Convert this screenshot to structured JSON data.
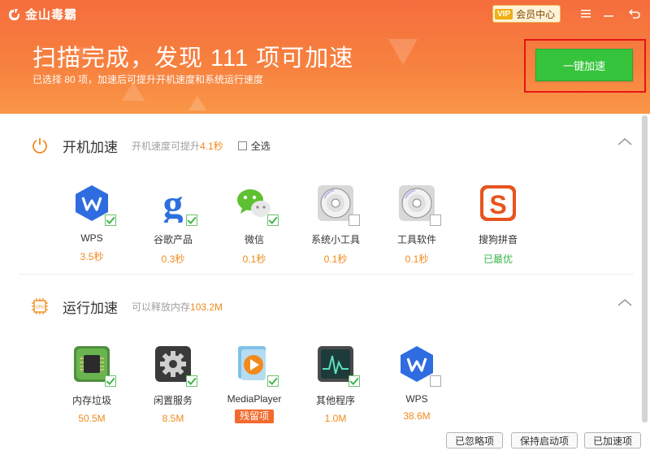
{
  "app": {
    "name": "金山毒霸"
  },
  "window_controls": {
    "vip_badge": "VIP",
    "vip_label": "会员中心"
  },
  "header": {
    "title": "扫描完成，发现 111 项可加速",
    "subtitle": "已选择 80 项，加速后可提升开机速度和系统运行速度",
    "accelerate_button": "一键加速"
  },
  "startup": {
    "title": "开机加速",
    "hint_prefix": "开机速度可提升",
    "hint_value": "4.1秒",
    "select_all_label": "全选",
    "items": [
      {
        "label": "WPS",
        "value": "3.5秒",
        "icon": "wps-icon",
        "checked": true
      },
      {
        "label": "谷歌产品",
        "value": "0.3秒",
        "icon": "google-icon",
        "checked": true
      },
      {
        "label": "微信",
        "value": "0.1秒",
        "icon": "wechat-icon",
        "checked": true
      },
      {
        "label": "系统小工具",
        "value": "0.1秒",
        "icon": "disc-icon",
        "checked": false
      },
      {
        "label": "工具软件",
        "value": "0.1秒",
        "icon": "disc-icon",
        "checked": false
      },
      {
        "label": "搜狗拼音",
        "value": "已最优",
        "icon": "sogou-icon",
        "checked": false
      }
    ]
  },
  "runtime": {
    "title": "运行加速",
    "hint_prefix": "可以释放内存",
    "hint_value": "103.2M",
    "items": [
      {
        "label": "内存垃圾",
        "value": "50.5M",
        "icon": "memory-chip-icon",
        "checked": true
      },
      {
        "label": "闲置服务",
        "value": "8.5M",
        "icon": "gear-icon",
        "checked": true
      },
      {
        "label": "MediaPlayer",
        "value": "残留项",
        "icon": "media-player-icon",
        "checked": true
      },
      {
        "label": "其他程序",
        "value": "1.0M",
        "icon": "monitor-icon",
        "checked": true
      },
      {
        "label": "WPS",
        "value": "38.6M",
        "icon": "wps-icon",
        "checked": false
      }
    ]
  },
  "footer": {
    "ignored_button": "已忽略项",
    "keep_startup_button": "保持启动项",
    "accelerated_button": "已加速项"
  },
  "colors": {
    "header": "#f56d3d",
    "accent": "#f08a1c",
    "primary_button": "#35c43b",
    "highlight_frame": "#e61414"
  }
}
